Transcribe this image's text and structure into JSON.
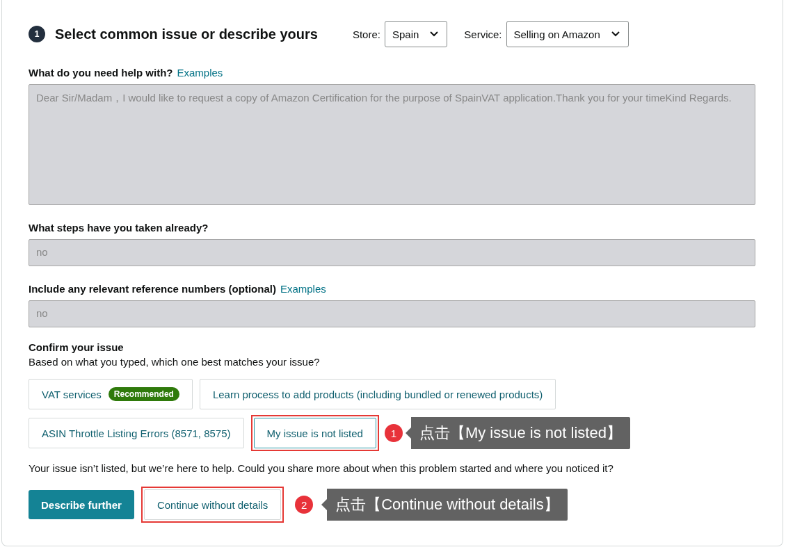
{
  "header": {
    "step": "1",
    "title": "Select common issue or describe yours",
    "store": {
      "label": "Store:",
      "value": "Spain"
    },
    "service": {
      "label": "Service:",
      "value": "Selling on Amazon"
    }
  },
  "help": {
    "label": "What do you need help with?",
    "link": "Examples",
    "value": "Dear Sir/Madam，I would like to request a copy of Amazon Certification for the purpose of SpainVAT application.Thank you for your timeKind Regards."
  },
  "steps": {
    "label": "What steps have you taken already?",
    "value": "no"
  },
  "reference": {
    "label": "Include any relevant reference numbers (optional)",
    "link": "Examples",
    "value": "no"
  },
  "confirm": {
    "title": "Confirm your issue",
    "subtitle": "Based on what you typed, which one best matches your issue?"
  },
  "options": [
    {
      "label": "VAT services",
      "badge": "Recommended",
      "selected": false
    },
    {
      "label": "Learn process to add products (including bundled or renewed products)",
      "selected": false
    },
    {
      "label": "ASIN Throttle Listing Errors (8571, 8575)",
      "selected": false
    },
    {
      "label": "My issue is not listed",
      "selected": true,
      "annotation": {
        "number": "1",
        "text": "点击【My issue is not listed】"
      }
    }
  ],
  "message": "Your issue isn’t listed, but we’re here to help. Could you share more about when this problem started and where you noticed it?",
  "primary_button": "Describe further",
  "secondary_button": {
    "label": "Continue without details",
    "annotation": {
      "number": "2",
      "text": "点击【Continue without details】"
    }
  }
}
